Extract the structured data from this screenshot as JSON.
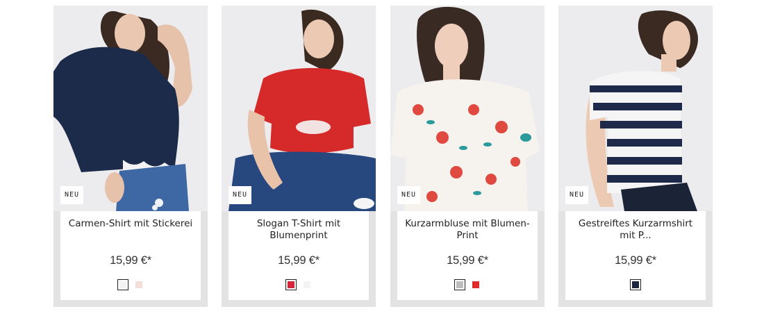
{
  "products": [
    {
      "badge": "NEU",
      "title": "Carmen-Shirt mit Stickerei",
      "price": "15,99 €*",
      "swatches": [
        {
          "color": "#f4f4f4",
          "selected": true
        },
        {
          "color": "#f3dfd8",
          "selected": false
        }
      ]
    },
    {
      "badge": "NEU",
      "title": "Slogan T-Shirt mit Blumenprint",
      "price": "15,99 €*",
      "swatches": [
        {
          "color": "#d4263a",
          "selected": true
        },
        {
          "color": "#f4f4f4",
          "selected": false
        }
      ]
    },
    {
      "badge": "NEU",
      "title": "Kurzarmbluse mit Blumen-Print",
      "price": "15,99 €*",
      "swatches": [
        {
          "color": "#bdbdbd",
          "selected": true
        },
        {
          "color": "#e02b2b",
          "selected": false
        }
      ]
    },
    {
      "badge": "NEU",
      "title": "Gestreiftes Kurzarmshirt mit P...",
      "price": "15,99 €*",
      "swatches": [
        {
          "color": "#1e2540",
          "selected": true
        }
      ]
    }
  ]
}
